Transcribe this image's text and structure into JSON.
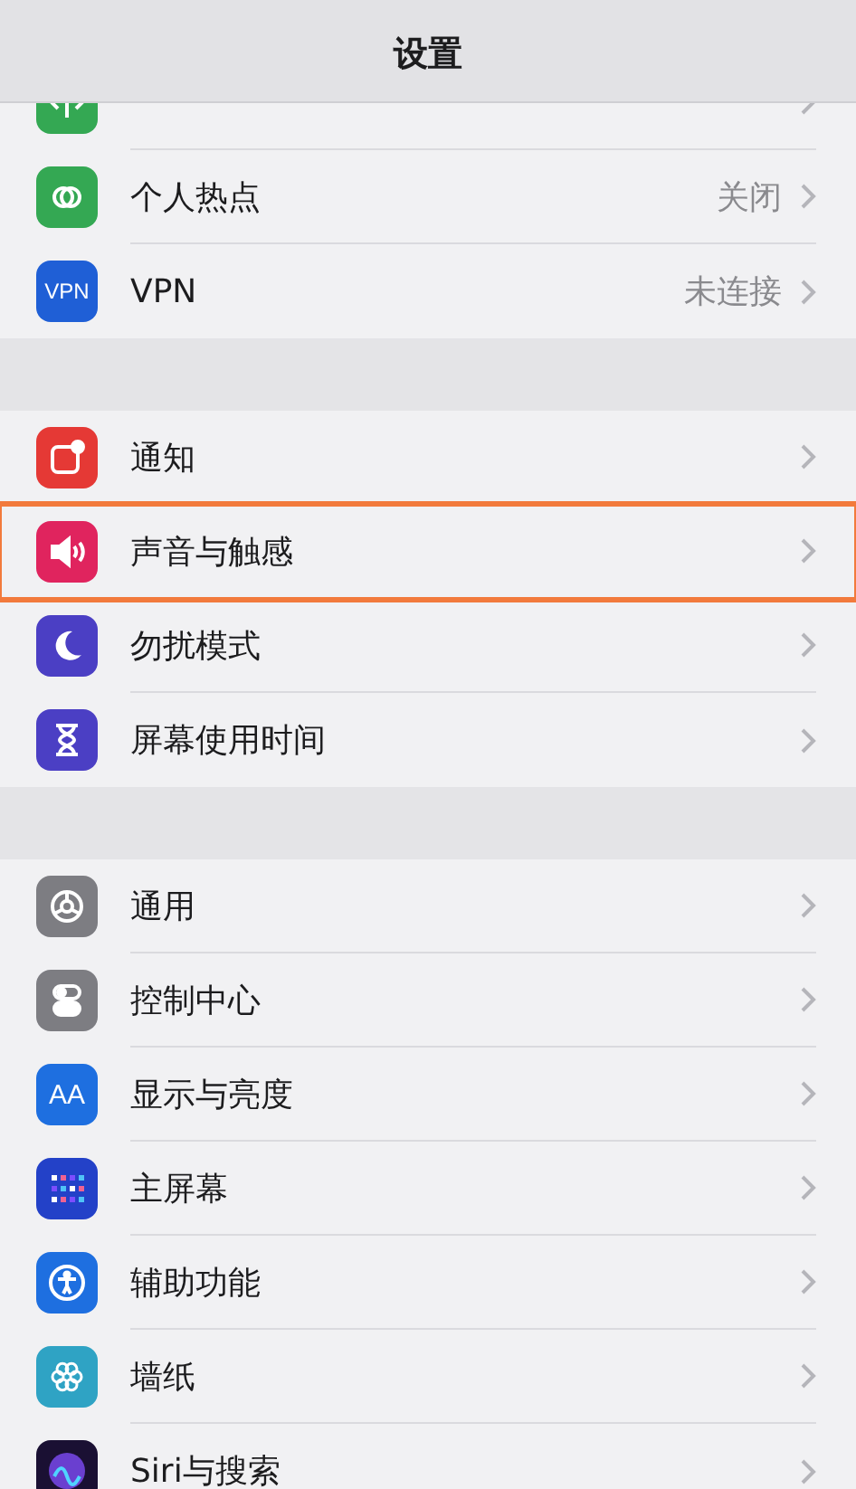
{
  "title": "设置",
  "groups": [
    {
      "items": [
        {
          "kind": "antenna",
          "cut": true,
          "highlighted": false
        },
        {
          "kind": "hotspot",
          "label": "个人热点",
          "value": "关闭",
          "highlighted": false
        },
        {
          "kind": "vpn",
          "icon_text": "VPN",
          "label": "VPN",
          "value": "未连接",
          "highlighted": false
        }
      ]
    },
    {
      "items": [
        {
          "kind": "notification",
          "label": "通知",
          "highlighted": false
        },
        {
          "kind": "sound",
          "label": "声音与触感",
          "highlighted": true
        },
        {
          "kind": "moon",
          "label": "勿扰模式",
          "highlighted": false
        },
        {
          "kind": "hourglass",
          "label": "屏幕使用时间",
          "highlighted": false
        }
      ]
    },
    {
      "items": [
        {
          "kind": "gear",
          "label": "通用",
          "highlighted": false
        },
        {
          "kind": "toggles",
          "label": "控制中心",
          "highlighted": false
        },
        {
          "kind": "text",
          "icon_text": "AA",
          "label": "显示与亮度",
          "highlighted": false
        },
        {
          "kind": "grid",
          "label": "主屏幕",
          "highlighted": false
        },
        {
          "kind": "person",
          "label": "辅助功能",
          "highlighted": false
        },
        {
          "kind": "flower",
          "label": "墙纸",
          "highlighted": false
        },
        {
          "kind": "orb",
          "label": "Siri与搜索",
          "highlighted": false
        }
      ]
    }
  ]
}
